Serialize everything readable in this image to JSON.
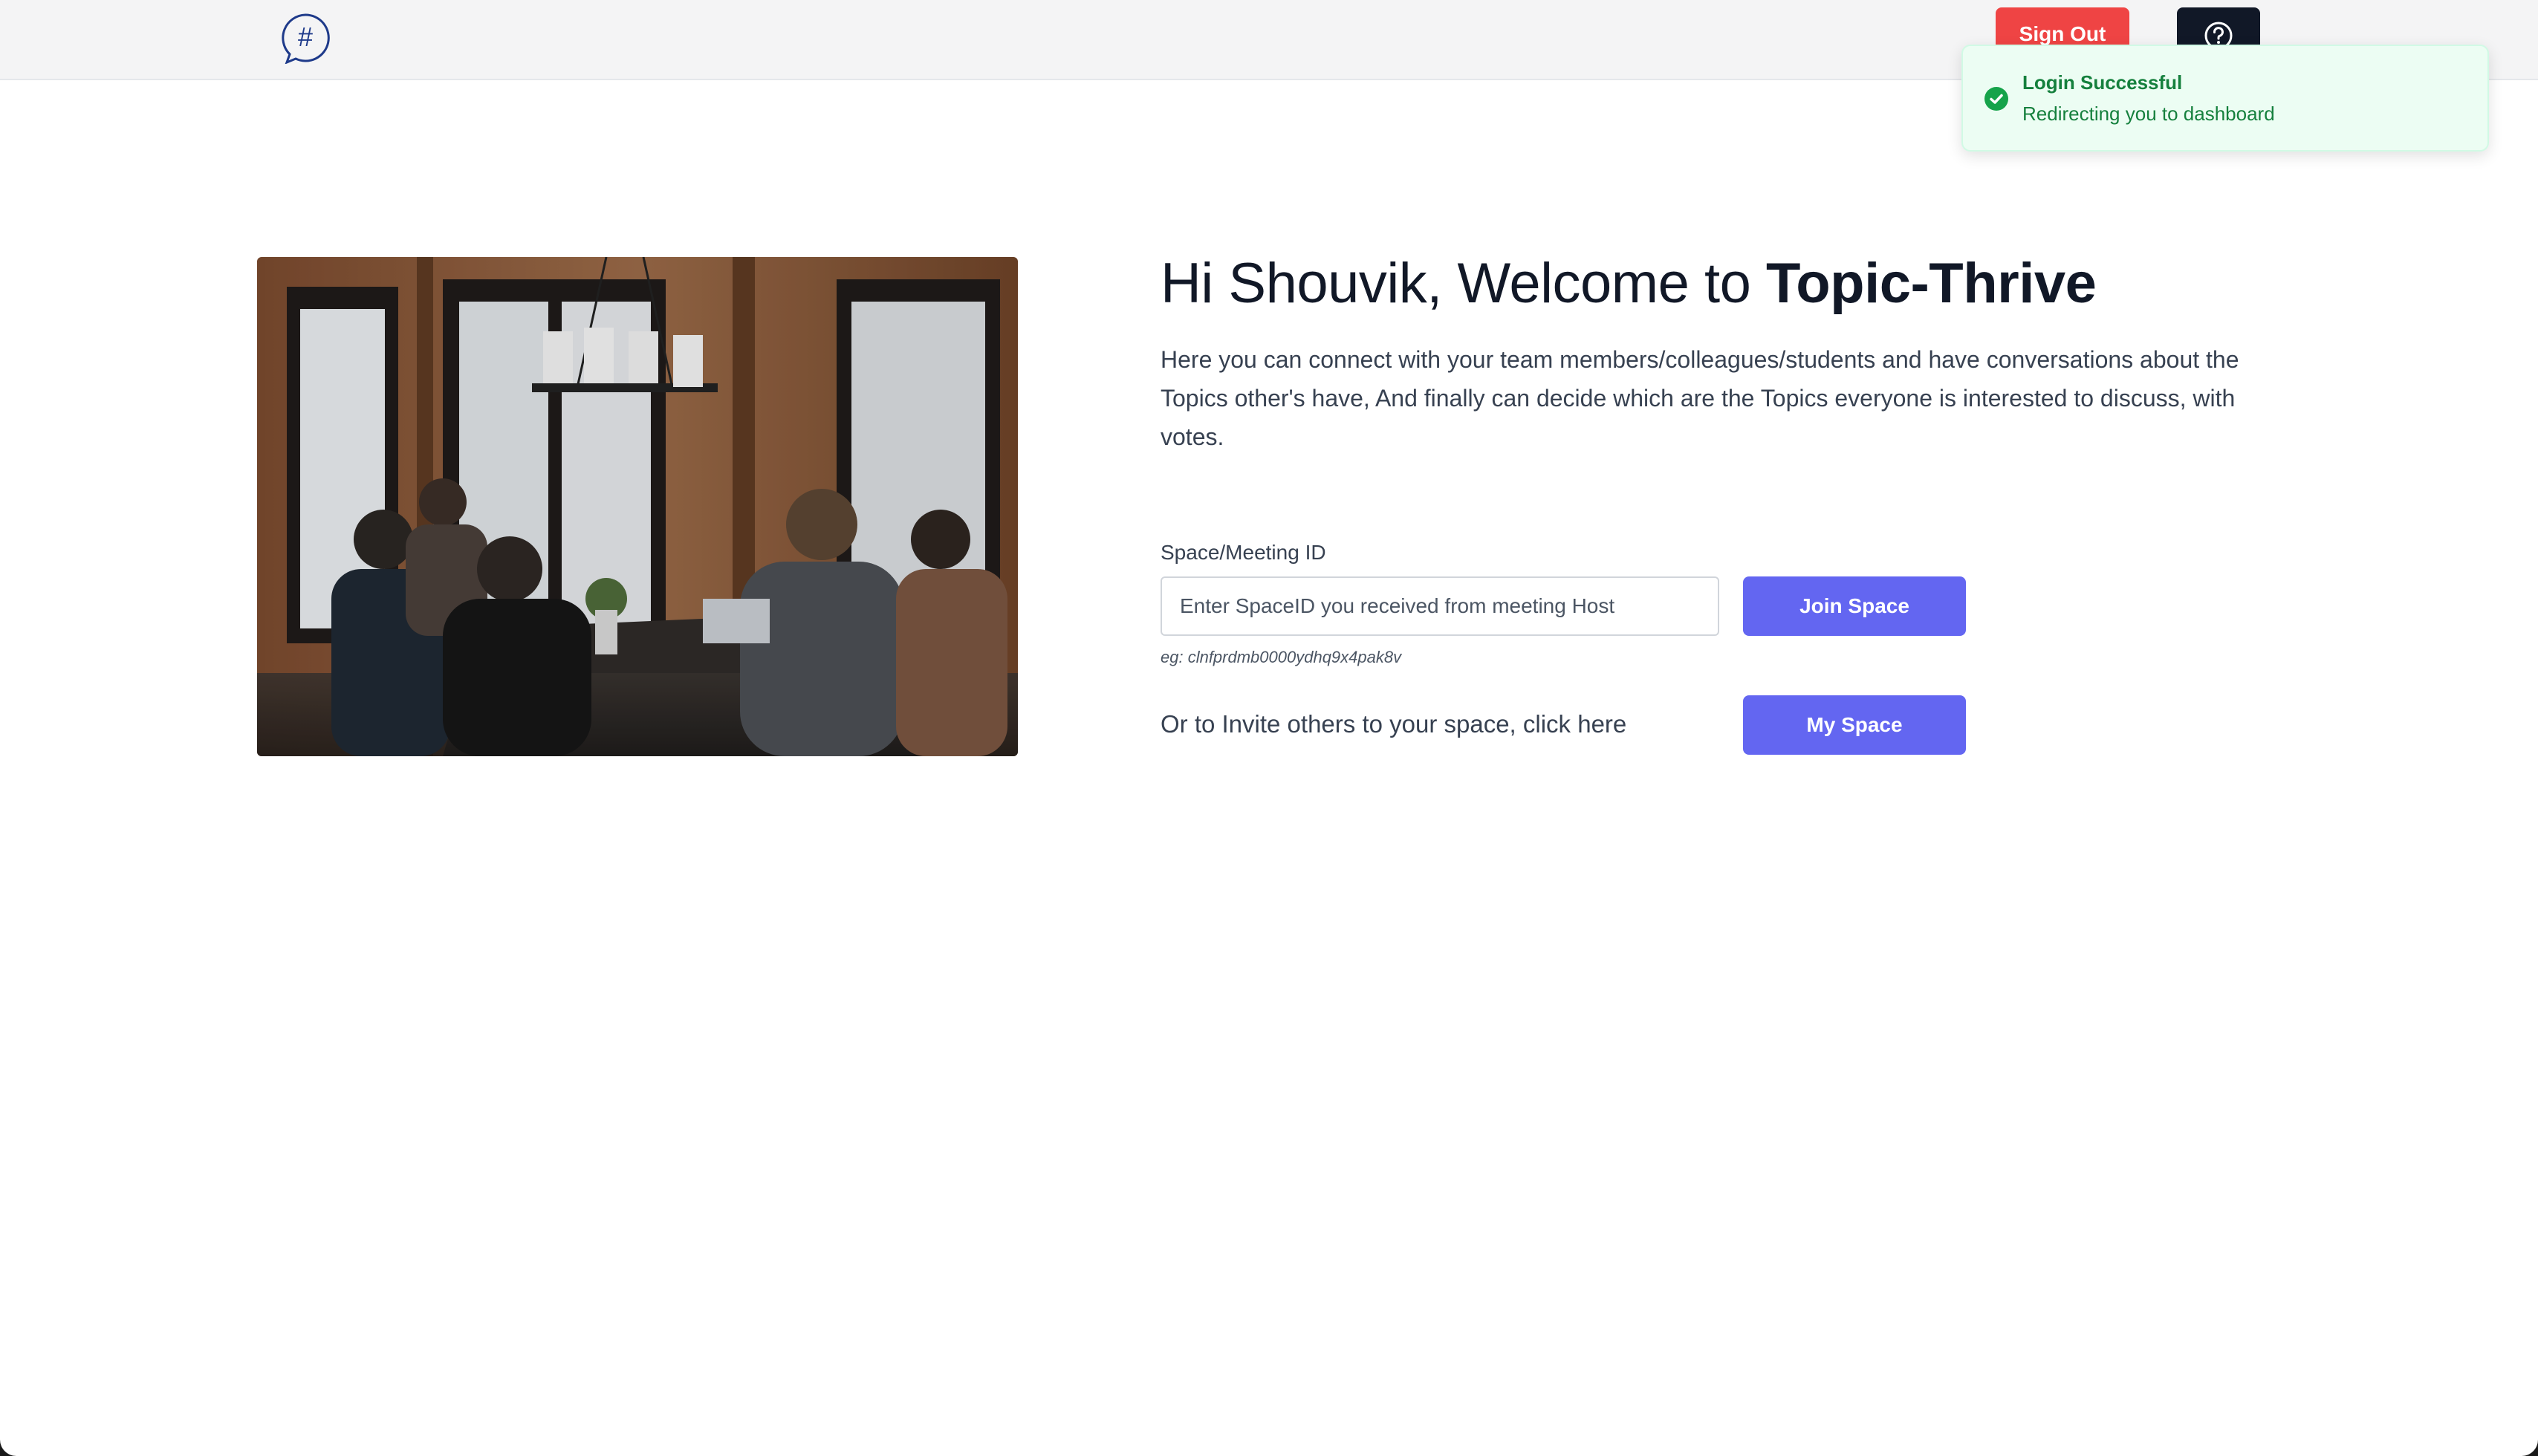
{
  "header": {
    "logo_glyph": "#",
    "signout_label": "Sign Out",
    "help_icon": "question-circle-icon"
  },
  "hero": {
    "greeting": "Hi Shouvik, Welcome to ",
    "app_name": "Topic-Thrive",
    "description": "Here you can connect with your team members/colleagues/students and have conversations about the Topics other's have, And finally can decide which are the Topics everyone is interested to discuss, with votes.",
    "image_alt": "Team meeting around a table"
  },
  "join_form": {
    "label": "Space/Meeting ID",
    "placeholder": "Enter SpaceID you received from meeting Host",
    "value": "",
    "hint": "eg: clnfprdmb0000ydhq9x4pak8v",
    "join_label": "Join Space"
  },
  "invite": {
    "text": "Or to Invite others to your space, click here",
    "button_label": "My Space"
  },
  "toast": {
    "title": "Login Successful",
    "message": "Redirecting you to dashboard",
    "icon": "check-circle-icon"
  },
  "colors": {
    "accent": "#6366f1",
    "danger": "#ef4444",
    "dark": "#111827",
    "success": "#15803d"
  }
}
